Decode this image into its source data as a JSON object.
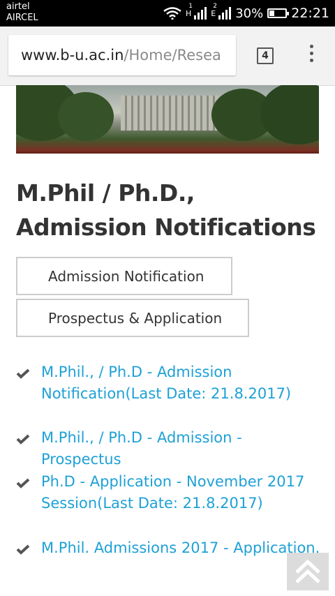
{
  "status": {
    "carrier1": "airtel",
    "carrier2": "AIRCEL",
    "net1": "H",
    "net1_sim": "1",
    "net2": "E",
    "net2_sim": "2",
    "battery": "30%",
    "battery_level": 0.3,
    "time": "22:21"
  },
  "browser": {
    "url_host": "www.b-u.ac.in",
    "url_path": "/Home/Resea",
    "tab_count": "4"
  },
  "page": {
    "title": "M.Phil / Ph.D., Admission Notifications",
    "buttons": {
      "admission": "Admission Notification",
      "prospectus": "Prospectus & Application"
    },
    "links": [
      "M.Phil., / Ph.D - Admission Notification(Last Date: 21.8.2017)",
      "M.Phil., / Ph.D - Admission - Prospectus",
      "Ph.D - Application - November 2017 Session(Last Date: 21.8.2017)",
      "M.Phil. Admissions 2017 - Application."
    ]
  },
  "colors": {
    "link": "#1ea1d6"
  }
}
